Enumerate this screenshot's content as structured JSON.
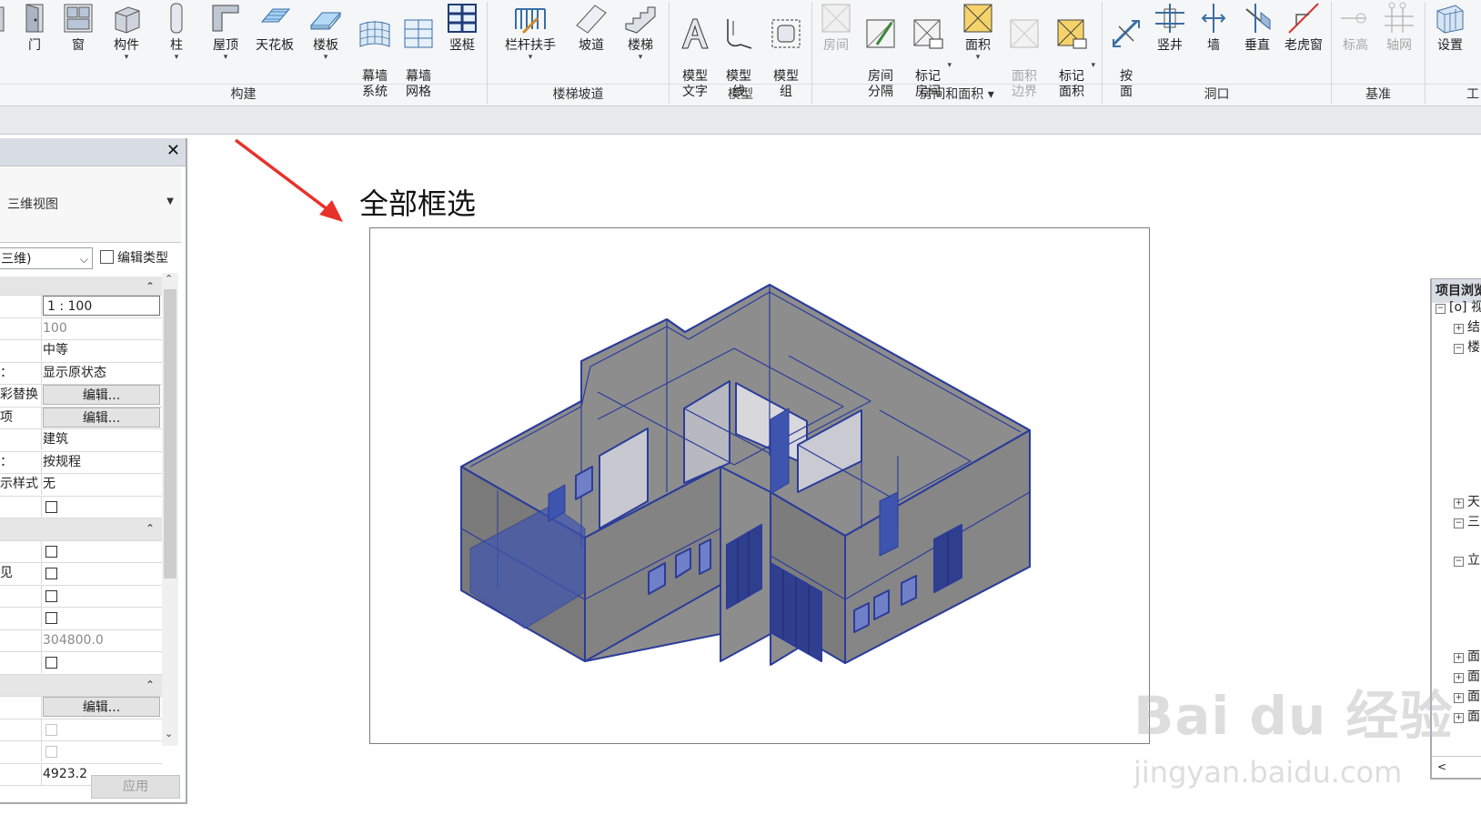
{
  "ribbon": {
    "items": [
      {
        "label": "门",
        "icon": "door-icon"
      },
      {
        "label": "窗",
        "icon": "window-icon"
      },
      {
        "label": "构件",
        "icon": "component-icon"
      },
      {
        "label": "柱",
        "icon": "column-icon"
      },
      {
        "label": "屋顶",
        "icon": "roof-icon"
      },
      {
        "label": "天花板",
        "icon": "ceiling-icon"
      },
      {
        "label": "楼板",
        "icon": "floor-icon"
      },
      {
        "label": "幕墙\n系统",
        "icon": "curtain-system-icon"
      },
      {
        "label": "幕墙\n网格",
        "icon": "curtain-grid-icon"
      },
      {
        "label": "竖梃",
        "icon": "mullion-icon"
      },
      {
        "label": "栏杆扶手",
        "icon": "railing-icon"
      },
      {
        "label": "坡道",
        "icon": "ramp-icon"
      },
      {
        "label": "楼梯",
        "icon": "stair-icon"
      },
      {
        "label": "模型\n文字",
        "icon": "model-text-icon"
      },
      {
        "label": "模型\n线",
        "icon": "model-line-icon"
      },
      {
        "label": "模型\n组",
        "icon": "model-group-icon"
      },
      {
        "label": "房间",
        "icon": "room-icon"
      },
      {
        "label": "房间\n分隔",
        "icon": "room-separator-icon"
      },
      {
        "label": "标记\n房间",
        "icon": "tag-room-icon"
      },
      {
        "label": "面积",
        "icon": "area-icon"
      },
      {
        "label": "面积\n边界",
        "icon": "area-boundary-icon"
      },
      {
        "label": "标记\n面积",
        "icon": "tag-area-icon"
      },
      {
        "label": "按\n面",
        "icon": "by-face-icon"
      },
      {
        "label": "竖井",
        "icon": "shaft-icon"
      },
      {
        "label": "墙",
        "icon": "wall-opening-icon"
      },
      {
        "label": "垂直",
        "icon": "vertical-opening-icon"
      },
      {
        "label": "老虎窗",
        "icon": "dormer-icon"
      },
      {
        "label": "标高",
        "icon": "level-icon"
      },
      {
        "label": "轴网",
        "icon": "grid-icon"
      },
      {
        "label": "设置",
        "icon": "set-workplane-icon"
      }
    ],
    "groups": [
      {
        "label": "构建"
      },
      {
        "label": "楼梯坡道"
      },
      {
        "label": "模型"
      },
      {
        "label": "房间和面积 ▾"
      },
      {
        "label": "洞口"
      },
      {
        "label": "基准"
      },
      {
        "label": "工"
      }
    ]
  },
  "properties": {
    "close": "✕",
    "type_name": "三维视图",
    "view_selector": "三维)",
    "edit_type_label": "编辑类型",
    "rows": [
      {
        "name": "",
        "value": "1 : 100",
        "style": "boxed"
      },
      {
        "name": "",
        "value": "100",
        "style": "gray"
      },
      {
        "name": "",
        "value": "中等"
      },
      {
        "name": "：",
        "value": "显示原状态"
      },
      {
        "name": "彩替换",
        "value": "编辑...",
        "style": "btn"
      },
      {
        "name": "项",
        "value": "编辑...",
        "style": "btn"
      },
      {
        "name": "",
        "value": "建筑"
      },
      {
        "name": "：",
        "value": "按规程"
      },
      {
        "name": "示样式",
        "value": "无"
      },
      {
        "name": "",
        "check": true
      },
      {
        "section": true
      },
      {
        "name": "",
        "check": true
      },
      {
        "name": "见",
        "check": true
      },
      {
        "name": "",
        "check": true
      },
      {
        "name": "",
        "check": true
      },
      {
        "name": "",
        "value": "304800.0",
        "style": "gray"
      },
      {
        "name": "",
        "check": true
      },
      {
        "section": true
      },
      {
        "name": "",
        "value": "编辑...",
        "style": "btn"
      },
      {
        "name": "",
        "check": true,
        "disabled": true
      },
      {
        "name": "",
        "check": true,
        "disabled": true
      },
      {
        "name": "",
        "value": "4923.2"
      }
    ],
    "apply_label": "应用"
  },
  "canvas": {
    "annotation": "全部框选",
    "colors": {
      "highlight": "#2b3c9a",
      "wall": "#7a7a7a",
      "arrow": "#e8312a"
    }
  },
  "browser": {
    "title": "项目浏览",
    "nodes": [
      {
        "toggle": "⊟",
        "label": "[o] 视"
      },
      {
        "toggle": "⊞",
        "label": "结"
      },
      {
        "toggle": "⊟",
        "label": "楼"
      },
      {
        "toggle": "⊞",
        "label": "天"
      },
      {
        "toggle": "⊟",
        "label": "三"
      },
      {
        "toggle": "⊟",
        "label": "立"
      },
      {
        "toggle": "⊞",
        "label": "面"
      },
      {
        "toggle": "⊞",
        "label": "面"
      },
      {
        "toggle": "⊞",
        "label": "面"
      },
      {
        "toggle": "⊞",
        "label": "面"
      }
    ],
    "scroll_left": "<"
  },
  "watermark": {
    "brand": "Bai du 经验",
    "url": "jingyan.baidu.com"
  }
}
